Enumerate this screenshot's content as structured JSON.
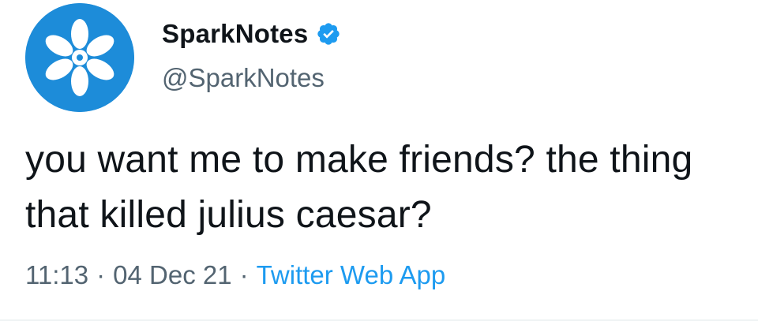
{
  "profile": {
    "display_name": "SparkNotes",
    "handle": "@SparkNotes",
    "verified": true,
    "avatar_icon": "sparknotes-asterisk-logo",
    "verified_icon": "verified-badge-icon"
  },
  "tweet": {
    "text": "you want me to make friends? the thing that killed julius caesar?"
  },
  "meta": {
    "time": "11:13",
    "separator": "·",
    "date": "04 Dec 21",
    "source": "Twitter Web App"
  },
  "colors": {
    "avatar_bg": "#1d8cd9",
    "verified": "#1d9bf0",
    "link": "#1d9bf0",
    "secondary_text": "#536471",
    "primary_text": "#0f1419"
  }
}
